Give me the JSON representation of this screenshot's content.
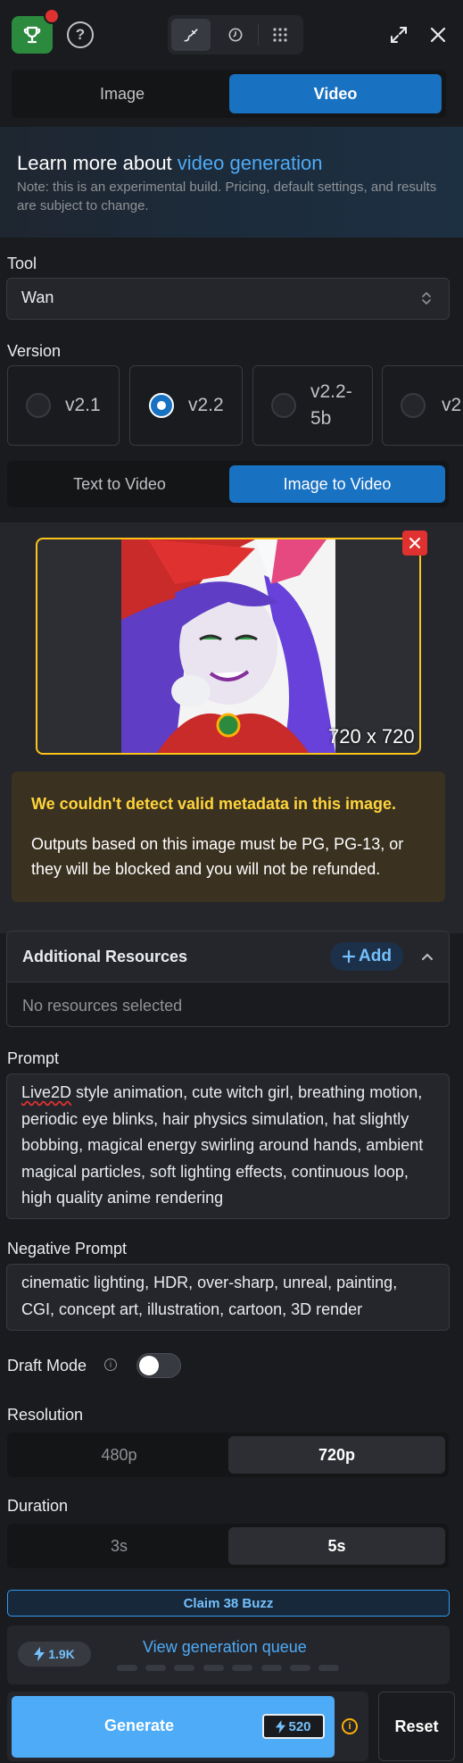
{
  "header": {
    "icons": [
      "trophy-icon",
      "help-icon",
      "brush-icon",
      "clock-icon",
      "grid-icon",
      "expand-icon",
      "close-icon"
    ],
    "help_glyph": "?"
  },
  "mode_toggle": {
    "options": [
      "Image",
      "Video"
    ],
    "selected": "Video"
  },
  "banner": {
    "title_prefix": "Learn more about ",
    "title_link": "video generation",
    "note": "Note: this is an experimental build. Pricing, default settings, and results are subject to change."
  },
  "tool": {
    "label": "Tool",
    "value": "Wan"
  },
  "version": {
    "label": "Version",
    "options": [
      "v2.1",
      "v2.2",
      "v2.2-5b",
      "v2"
    ],
    "selected": "v2.2"
  },
  "video_type": {
    "options": [
      "Text to Video",
      "Image to Video"
    ],
    "selected": "Image to Video"
  },
  "image": {
    "dimensions": "720 x 720"
  },
  "warning": {
    "title": "We couldn't detect valid metadata in this image.",
    "body": "Outputs based on this image must be PG, PG-13, or they will be blocked and you will not be refunded."
  },
  "resources": {
    "title": "Additional Resources",
    "add_label": "Add",
    "empty_text": "No resources selected"
  },
  "prompt": {
    "label": "Prompt",
    "first_word": "Live2D",
    "value_rest": " style animation, cute witch girl, breathing motion, periodic eye blinks, hair physics simulation, hat slightly bobbing, magical energy swirling around hands, ambient magical particles, soft lighting effects, continuous loop, high quality anime rendering"
  },
  "negative_prompt": {
    "label": "Negative Prompt",
    "value": "cinematic lighting, HDR, over-sharp, unreal, painting, CGI, concept art, illustration, cartoon, 3D render"
  },
  "draft_mode": {
    "label": "Draft Mode",
    "enabled": false
  },
  "resolution": {
    "label": "Resolution",
    "options": [
      "480p",
      "720p"
    ],
    "selected": "720p"
  },
  "duration": {
    "label": "Duration",
    "options": [
      "3s",
      "5s"
    ],
    "selected": "5s"
  },
  "claim": {
    "label": "Claim 38 Buzz"
  },
  "queue": {
    "buzz_balance": "1.9K",
    "link_label": "View generation queue"
  },
  "actions": {
    "generate_label": "Generate",
    "cost": "520",
    "reset_label": "Reset"
  },
  "colors": {
    "accent": "#1971c2",
    "link": "#4dabf7",
    "warning": "#ffd43b",
    "danger": "#e03131",
    "brand_green": "#2b8a3e"
  }
}
